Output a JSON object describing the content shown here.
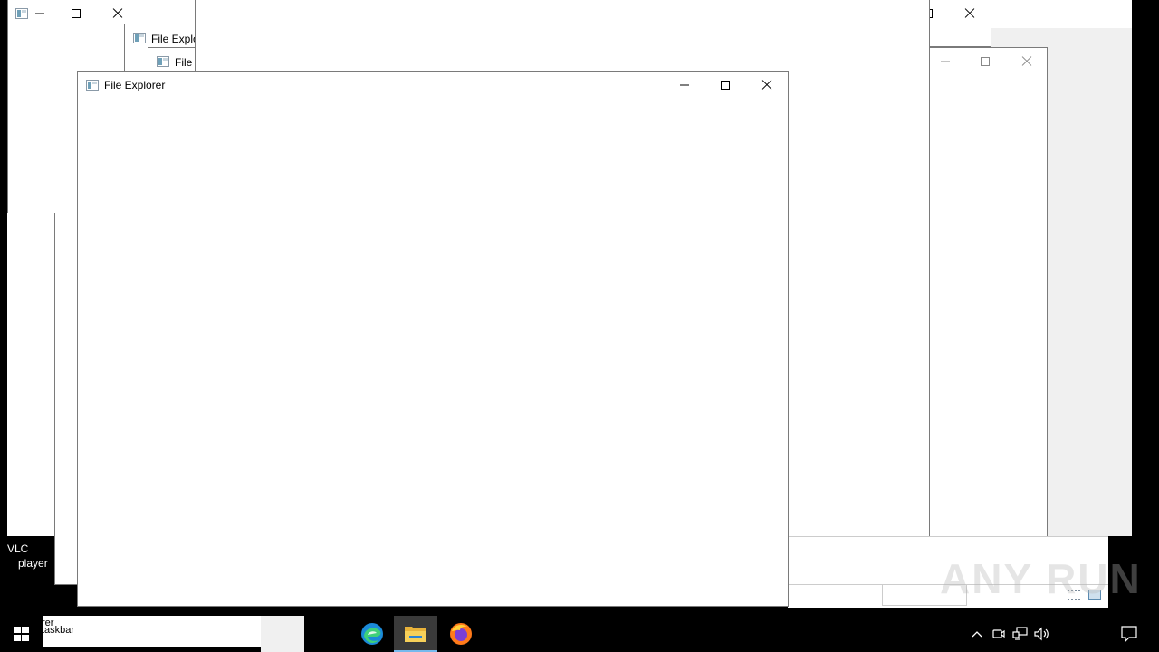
{
  "background_windows": [
    {
      "title": "",
      "has_controls": true
    },
    {
      "title": "File Explo",
      "has_controls": false
    },
    {
      "title": "File",
      "has_controls": false
    },
    {
      "title": "",
      "has_controls": true
    },
    {
      "title": "",
      "has_controls": true
    }
  ],
  "main_window": {
    "title": "File Explorer",
    "icon": "file-explorer-app-icon",
    "controls": [
      "minimize-icon",
      "maximize-icon",
      "close-icon"
    ]
  },
  "desktop_icons": [
    {
      "label_line1": "VLC",
      "label_line2": "player"
    }
  ],
  "taskbar": {
    "search_line1": "rer",
    "search_line2": "taskbar",
    "apps": [
      {
        "name": "edge-icon",
        "active": false
      },
      {
        "name": "file-explorer-icon",
        "active": true
      },
      {
        "name": "firefox-icon",
        "active": false
      }
    ],
    "tray": [
      "chevron-up-icon",
      "meet-now-icon",
      "network-icon",
      "volume-icon",
      "notification-icon"
    ]
  },
  "watermark_text": "ANY RUN",
  "colors": {
    "desktop": "#000000",
    "window": "#ffffff",
    "taskbar": "#000000",
    "active_indicator": "#76b9ed"
  }
}
